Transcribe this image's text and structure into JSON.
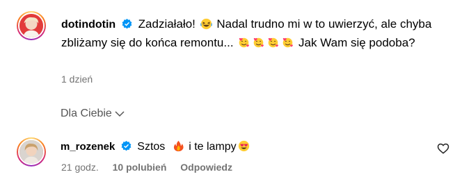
{
  "post": {
    "username": "dotindotin",
    "text_part1": "Zadziałało!",
    "text_part2": "Nadal trudno mi w to uwierzyć, ale chyba zbliżamy się do końca remontu...",
    "text_part3": "Jak Wam się podoba?",
    "time": "1 dzień"
  },
  "filter": {
    "label": "Dla Ciebie"
  },
  "comment": {
    "username": "m_rozenek",
    "text_part1": "Sztos",
    "text_part2": "i te lampy",
    "time": "21 godz.",
    "likes": "10 polubień",
    "reply_label": "Odpowiedz"
  },
  "icons": {
    "verified": "verified-badge-icon",
    "laugh_emoji": "grinning-squinting-face-emoji",
    "hearts_emoji": "smiling-face-with-hearts-emoji",
    "fire_emoji": "fire-emoji",
    "heart_eyes_emoji": "smiling-face-with-heart-eyes-emoji",
    "chevron": "chevron-down-icon",
    "like": "heart-outline-icon"
  },
  "colors": {
    "verified_blue": "#0095f6",
    "muted_text": "#737373"
  }
}
